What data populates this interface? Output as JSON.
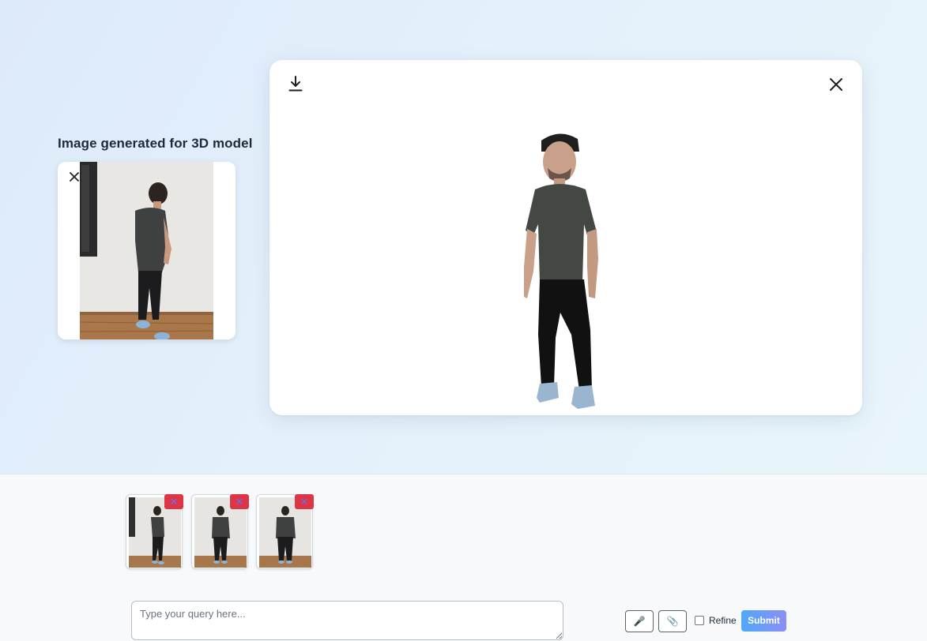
{
  "generated": {
    "title": "Image generated for 3D model",
    "close_icon": "close-icon",
    "download_icon": "download-icon"
  },
  "viewer": {
    "download_icon": "download-icon",
    "close_icon": "close-icon"
  },
  "thumbnails": [
    {
      "pose": "side",
      "remove_symbol": "✕"
    },
    {
      "pose": "front",
      "remove_symbol": "✕"
    },
    {
      "pose": "back",
      "remove_symbol": "✕"
    }
  ],
  "composer": {
    "query_placeholder": "Type your query here...",
    "mic_icon": "microphone-icon",
    "mic_glyph": "🎤",
    "attach_icon": "paperclip-icon",
    "attach_glyph": "📎",
    "refine_label": "Refine",
    "refine_checked": false,
    "submit_label": "Submit"
  },
  "colors": {
    "remove_badge": "#dc3545",
    "submit_gradient_start": "#4fa8f8",
    "submit_gradient_end": "#8c8ff5"
  }
}
